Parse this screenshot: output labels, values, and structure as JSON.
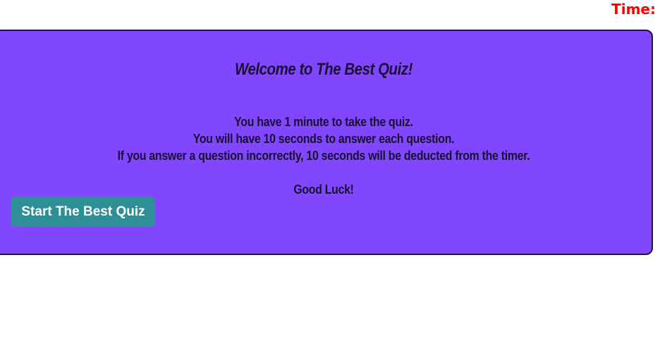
{
  "header": {
    "timer_label": "Time:"
  },
  "card": {
    "title": "Welcome to The Best Quiz!",
    "instructions": [
      "You have 1 minute to take the quiz.",
      "You will have 10 seconds to answer each question.",
      "If you answer a question incorrectly, 10 seconds will be deducted from the timer."
    ],
    "closing": "Good Luck!",
    "start_button_label": "Start The Best Quiz"
  },
  "colors": {
    "card_background": "#8047ff",
    "timer_text": "#ff0000",
    "button_background": "#2e8f96",
    "card_text": "#1a1030"
  }
}
